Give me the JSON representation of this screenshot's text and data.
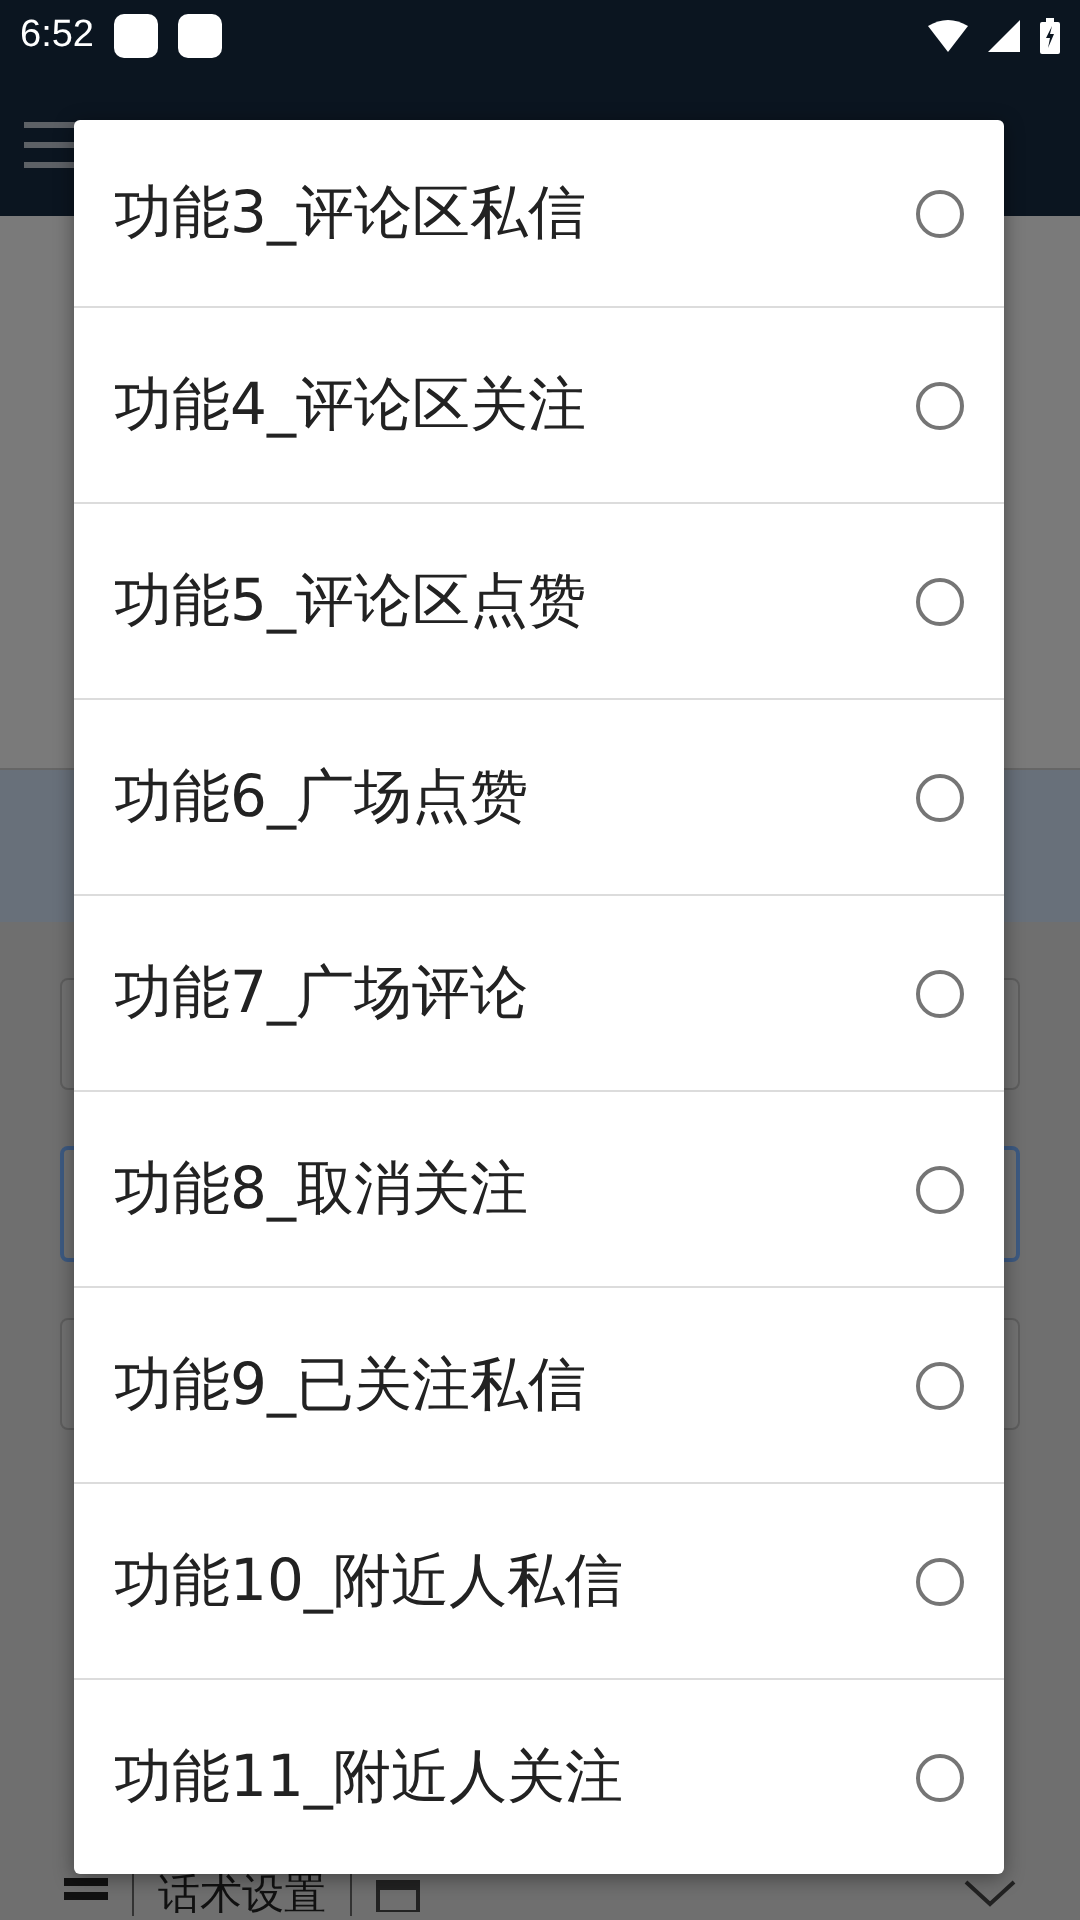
{
  "status_bar": {
    "time": "6:52"
  },
  "background": {
    "section_label": "话术设置"
  },
  "dialog": {
    "options": [
      {
        "label": "功能3_评论区私信",
        "selected": false
      },
      {
        "label": "功能4_评论区关注",
        "selected": false
      },
      {
        "label": "功能5_评论区点赞",
        "selected": false
      },
      {
        "label": "功能6_广场点赞",
        "selected": false
      },
      {
        "label": "功能7_广场评论",
        "selected": false
      },
      {
        "label": "功能8_取消关注",
        "selected": false
      },
      {
        "label": "功能9_已关注私信",
        "selected": false
      },
      {
        "label": "功能10_附近人私信",
        "selected": false
      },
      {
        "label": "功能11_附近人关注",
        "selected": false
      }
    ]
  }
}
